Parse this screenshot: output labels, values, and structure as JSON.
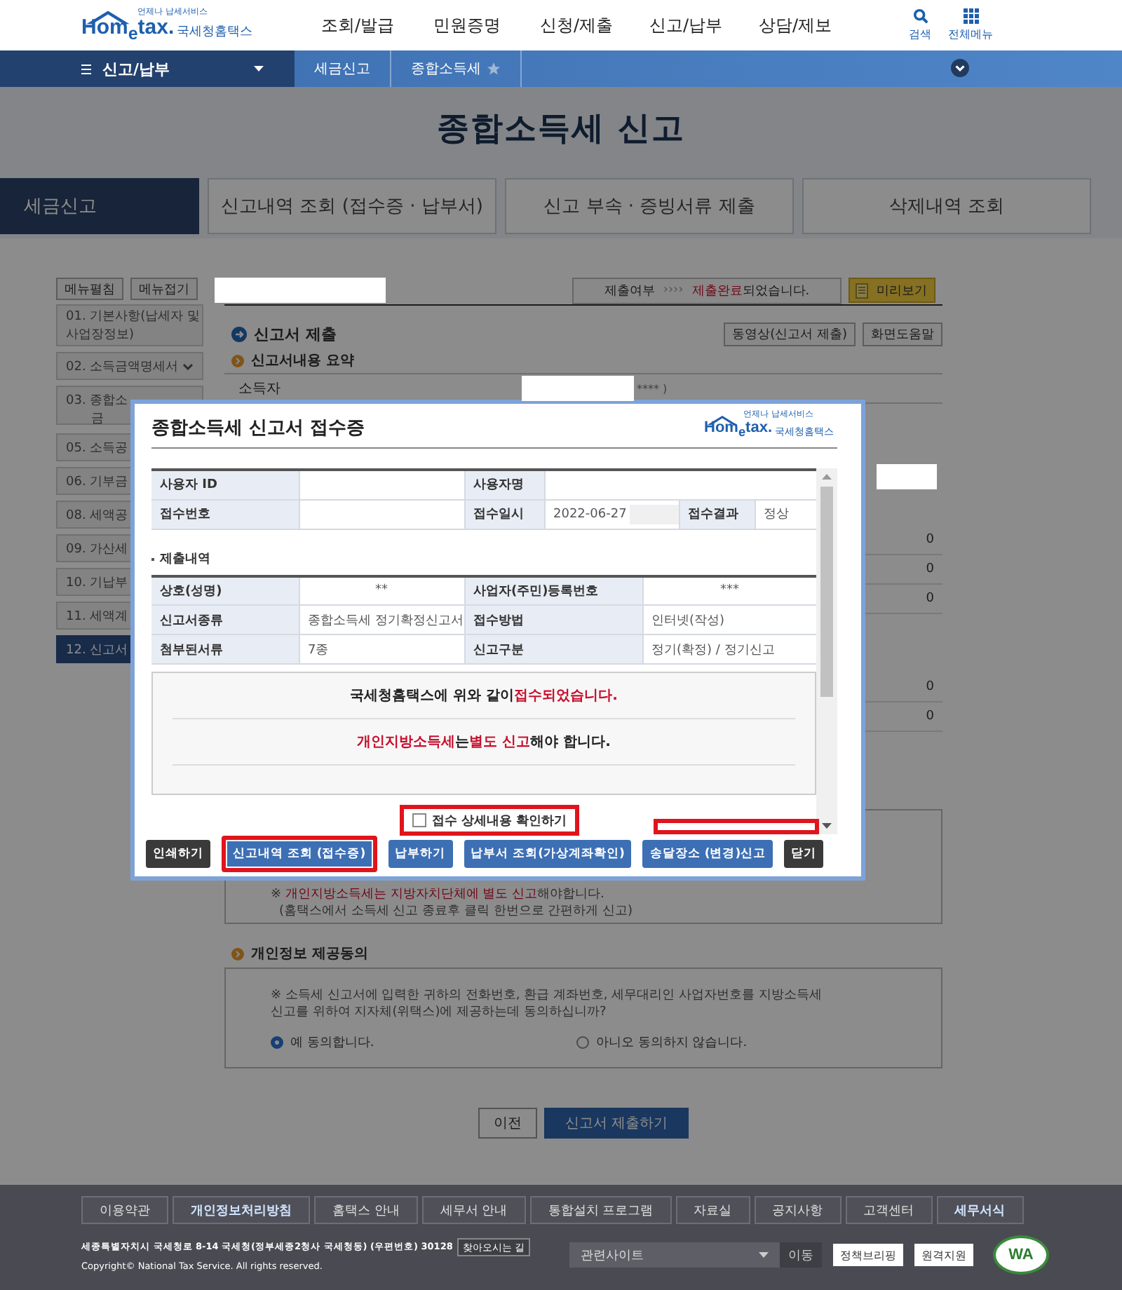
{
  "header": {
    "logo": {
      "tagline": "언제나 납세서비스",
      "word": "Hom$_{e}$tax.",
      "name": "국세청홈택스"
    },
    "nav": [
      "조회/발급",
      "민원증명",
      "신청/제출",
      "신고/납부",
      "상담/제보"
    ],
    "tools": [
      {
        "kind": "search",
        "label": "검색"
      },
      {
        "kind": "menu",
        "label": "전체메뉴"
      }
    ]
  },
  "breadcrumb": {
    "menu": "신고/납부",
    "items": [
      {
        "label": "세금신고",
        "starred": false
      },
      {
        "label": "종합소득세",
        "starred": true
      }
    ]
  },
  "hero": {
    "title": "종합소득세 신고",
    "tabs": [
      {
        "label": "세금신고",
        "selected": true
      },
      {
        "label": "신고내역 조회 (접수증 · 납부서)",
        "selected": false
      },
      {
        "label": "신고 부속 · 증빙서류 제출",
        "selected": false
      },
      {
        "label": "삭제내역 조회",
        "selected": false
      }
    ]
  },
  "sidebar": {
    "buttons": [
      "메뉴펼침",
      "메뉴접기"
    ],
    "items": [
      {
        "lines": [
          "01. 기본사항(납세자 및",
          "사업장정보)"
        ],
        "selected": false
      },
      {
        "lines": [
          "02. 소득금액명세서"
        ],
        "expandable": true,
        "selected": false
      },
      {
        "lines": [
          "03. 종합소",
          "금"
        ],
        "selected": false
      },
      {
        "lines": [
          "05. 소득공"
        ],
        "selected": false
      },
      {
        "lines": [
          "06. 기부금"
        ],
        "selected": false
      },
      {
        "lines": [
          "08. 세액공"
        ],
        "selected": false
      },
      {
        "lines": [
          "09. 가산세"
        ],
        "selected": false
      },
      {
        "lines": [
          "10. 기납부"
        ],
        "selected": false
      },
      {
        "lines": [
          "11. 세액계"
        ],
        "selected": false
      },
      {
        "lines": [
          "12. 신고서"
        ],
        "selected": true
      }
    ]
  },
  "main": {
    "status": {
      "label": "제출여부",
      "arrows": "››››",
      "message": [
        {
          "text": "제출완료",
          "emphasis": true
        },
        {
          "text": "되었습니다.",
          "emphasis": false
        }
      ]
    },
    "preview_button": "미리보기",
    "section_title": "신고서 제출",
    "help_buttons": [
      "동영상(신고서 제출)",
      "화면도움말"
    ],
    "summary_title": "신고서내용 요약",
    "taxpayer": {
      "label": "소득자",
      "value": "**** )"
    },
    "summary_values": [
      [
        "0",
        "0",
        "0"
      ],
      [
        "0",
        "0"
      ]
    ],
    "notes": [
      [
        {
          "text": "※ ",
          "emphasis": false
        },
        {
          "text": "개인지방소득세는 지방자치단체에 별도 신고",
          "emphasis": true
        },
        {
          "text": "해야합니다.",
          "emphasis": false
        }
      ],
      [
        {
          "text": "(홈택스에서 소득세 신고 종료후 클릭 한번으로 간편하게 신고)",
          "emphasis": false
        }
      ]
    ],
    "consent": {
      "title": "개인정보 제공동의",
      "question": "※ 소득세 신고서에 입력한 귀하의 전화번호, 환급 계좌번호, 세무대리인 사업자번호를 지방소득세 신고를 위하여 지자체(위택스)에 제공하는데 동의하십니까?",
      "options": [
        {
          "label": "예 동의합니다.",
          "selected": true
        },
        {
          "label": "아니오 동의하지 않습니다.",
          "selected": false
        }
      ]
    },
    "nav_buttons": [
      {
        "label": "이전",
        "kind": "plain"
      },
      {
        "label": "신고서 제출하기",
        "kind": "primary"
      }
    ]
  },
  "modal": {
    "title": "종합소득세 신고서 접수증",
    "logo": {
      "tagline": "언제나 납세서비스",
      "word": "Hom$_{e}$tax.",
      "name": "국세청홈택스"
    },
    "info_rows": [
      [
        {
          "kind": "label",
          "text": "사용자 ID"
        },
        {
          "kind": "blank"
        },
        {
          "kind": "label",
          "text": "사용자명"
        },
        {
          "kind": "blank"
        }
      ],
      [
        {
          "kind": "label",
          "text": "접수번호"
        },
        {
          "kind": "blank"
        },
        {
          "kind": "label",
          "text": "접수일시"
        },
        {
          "kind": "blurred",
          "text": "2022-06-27"
        },
        {
          "kind": "label",
          "text": "접수결과"
        },
        {
          "kind": "value",
          "text": "정상"
        }
      ]
    ],
    "section": "제출내역",
    "detail_rows": [
      [
        {
          "kind": "label",
          "text": "상호(성명)"
        },
        {
          "kind": "center",
          "text": "**"
        },
        {
          "kind": "label",
          "text": "사업자(주민)등록번호"
        },
        {
          "kind": "center",
          "text": "***"
        }
      ],
      [
        {
          "kind": "label",
          "text": "신고서종류"
        },
        {
          "kind": "value",
          "text": "종합소득세 정기확정신고서"
        },
        {
          "kind": "label",
          "text": "접수방법"
        },
        {
          "kind": "value",
          "text": "인터넷(작성)"
        }
      ],
      [
        {
          "kind": "label",
          "text": "첨부된서류"
        },
        {
          "kind": "value",
          "text": "7종"
        },
        {
          "kind": "label",
          "text": "신고구분"
        },
        {
          "kind": "value",
          "text": "정기(확정) / 정기신고"
        }
      ]
    ],
    "messages": [
      [
        {
          "text": "국세청홈택스에 위와 같이 ",
          "emphasis": false
        },
        {
          "text": "접수되었습니다.",
          "emphasis": true
        }
      ],
      [
        {
          "text": "개인지방소득세",
          "emphasis": true
        },
        {
          "text": "는 ",
          "emphasis": false
        },
        {
          "text": "별도 신고",
          "emphasis": true
        },
        {
          "text": "해야 합니다.",
          "emphasis": false
        }
      ]
    ],
    "checkbox": {
      "label": "접수 상세내용 확인하기",
      "checked": false,
      "highlighted": true
    },
    "buttons": [
      {
        "label": "인쇄하기",
        "kind": "dark",
        "highlighted": false
      },
      {
        "label": "신고내역 조회 (접수증)",
        "kind": "primary",
        "highlighted": true
      },
      {
        "label": "납부하기",
        "kind": "primary",
        "highlighted": false
      },
      {
        "label": "납부서 조회(가상계좌확인)",
        "kind": "primary",
        "highlighted": false
      },
      {
        "label": "송달장소 (변경)신고",
        "kind": "primary",
        "highlighted": false
      },
      {
        "label": "닫기",
        "kind": "dark",
        "highlighted": false
      }
    ]
  },
  "footer": {
    "links": [
      {
        "label": "이용약관",
        "highlighted": false
      },
      {
        "label": "개인정보처리방침",
        "highlighted": true
      },
      {
        "label": "홈택스 안내",
        "highlighted": false
      },
      {
        "label": "세무서 안내",
        "highlighted": false
      },
      {
        "label": "통합설치 프로그램",
        "highlighted": false
      },
      {
        "label": "자료실",
        "highlighted": false
      },
      {
        "label": "공지사항",
        "highlighted": false
      },
      {
        "label": "고객센터",
        "highlighted": false
      },
      {
        "label": "세무서식",
        "highlighted": true
      }
    ],
    "address": "세종특별자치시 국세청로 8-14 국세청(정부세종2청사 국세청동) (우편번호) 30128",
    "directions": "찾아오시는 길",
    "site_select": "관련사이트",
    "go": "이동",
    "badges": [
      "정책브리핑",
      "원격지원"
    ],
    "mark": "WA",
    "copyright": "Copyright© National Tax Service. All rights reserved."
  }
}
